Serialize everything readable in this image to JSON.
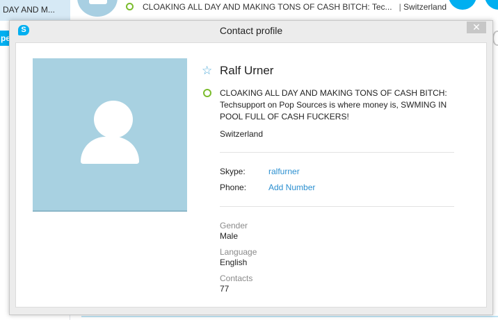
{
  "background": {
    "chat_title": "DAY AND M...",
    "left_accent_text": "pe",
    "mood": "CLOAKING ALL DAY AND MAKING TONS OF CASH BITCH: Tec...",
    "separator": "|",
    "location": "Switzerland"
  },
  "dialog": {
    "title": "Contact profile",
    "app_icon": "skype-logo-icon",
    "close_label": "✕"
  },
  "profile": {
    "avatar_icon": "default-user-avatar-icon",
    "favorite_icon": "star-outline-icon",
    "name": "Ralf Urner",
    "status_icon": "online-status-ring-icon",
    "mood": "CLOAKING ALL DAY AND MAKING TONS OF CASH BITCH: Techsupport on Pop Sources is where money is, SWMING IN POOL FULL OF CASH FUCKERS!",
    "location": "Switzerland"
  },
  "details": {
    "skype_label": "Skype:",
    "skype_value": "ralfurner",
    "phone_label": "Phone:",
    "phone_value": "Add Number"
  },
  "meta": {
    "gender_label": "Gender",
    "gender_value": "Male",
    "language_label": "Language",
    "language_value": "English",
    "contacts_label": "Contacts",
    "contacts_value": "77"
  },
  "colors": {
    "accent": "#00aff0",
    "link": "#2b8fd0",
    "status_online": "#7bbc2c",
    "avatar_bg": "#a8d1e1"
  }
}
